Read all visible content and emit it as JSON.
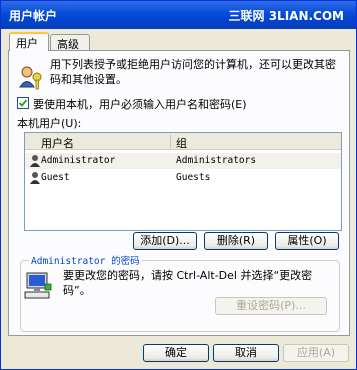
{
  "window": {
    "title": "用户帐户",
    "watermark": "三联网 3LIAN.COM",
    "close_glyph": "×"
  },
  "tabs": [
    {
      "label": "用户"
    },
    {
      "label": "高级"
    }
  ],
  "intro_text": "用下列表授予或拒绝用户访问您的计算机，还可以更改其密码和其他设置。",
  "require_login_checkbox": {
    "label": "要使用本机，用户必须输入用户名和密码(E)",
    "checked": true
  },
  "local_users_label": "本机用户(U):",
  "users_table": {
    "columns": [
      "用户名",
      "组"
    ],
    "rows": [
      {
        "user": "Administrator",
        "group": "Administrators"
      },
      {
        "user": "Guest",
        "group": "Guests"
      }
    ]
  },
  "buttons": {
    "add": "添加(D)...",
    "remove": "删除(R)",
    "properties": "属性(O)",
    "reset_password": "重设密码(P)...",
    "ok": "确定",
    "cancel": "取消",
    "apply": "应用(A)"
  },
  "password_group": {
    "title": "Administrator 的密码",
    "text": "要更改您的密码，请按 Ctrl-Alt-Del 并选择“更改密码”。"
  },
  "colors": {
    "title_bar": "#0a4fd8",
    "group_title": "#0046d5",
    "dialog_bg": "#ece9d8"
  }
}
